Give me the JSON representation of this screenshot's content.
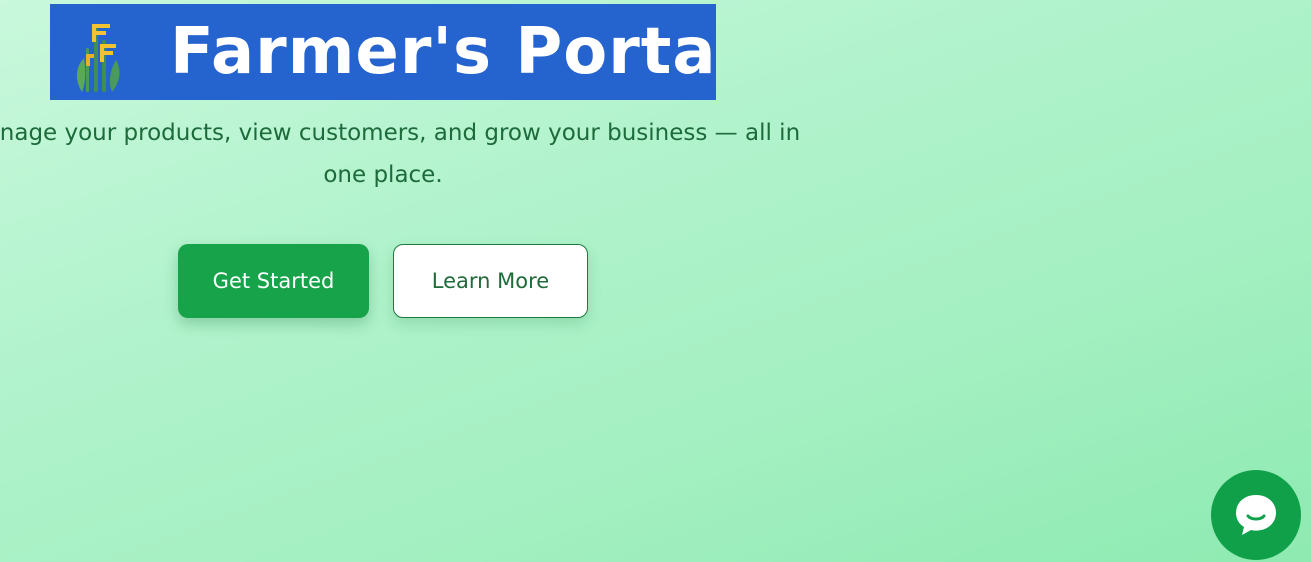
{
  "hero": {
    "title": "Farmer's Portal",
    "tagline": "Manage your products, view customers, and grow your business — all in one place.",
    "logo_icon": "wheat-logo-icon",
    "banner_color": "#2563cf"
  },
  "actions": {
    "primary_label": "Get Started",
    "secondary_label": "Learn More",
    "primary_color": "#17a34a"
  },
  "chat": {
    "icon": "chat-bubble-icon",
    "color": "#10a04a"
  }
}
